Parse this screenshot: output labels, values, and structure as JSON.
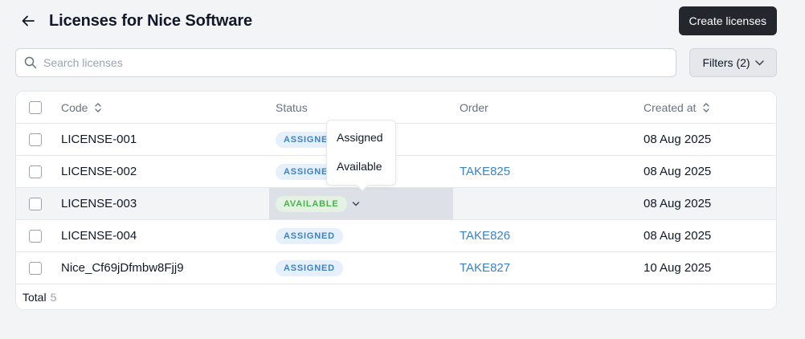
{
  "header": {
    "title": "Licenses for Nice Software",
    "create_label": "Create licenses"
  },
  "search": {
    "placeholder": "Search licenses",
    "value": ""
  },
  "filters": {
    "label": "Filters (2)"
  },
  "table": {
    "columns": [
      "Code",
      "Status",
      "Order",
      "Created at"
    ],
    "rows": [
      {
        "code": "LICENSE-001",
        "status": "ASSIGNED",
        "order": "",
        "created": "08 Aug 2025"
      },
      {
        "code": "LICENSE-002",
        "status": "ASSIGNED",
        "order": "TAKE825",
        "created": "08 Aug 2025"
      },
      {
        "code": "LICENSE-003",
        "status": "AVAILABLE",
        "order": "",
        "created": "08 Aug 2025"
      },
      {
        "code": "LICENSE-004",
        "status": "ASSIGNED",
        "order": "TAKE826",
        "created": "08 Aug 2025"
      },
      {
        "code": "Nice_Cf69jDfmbw8Fjj9",
        "status": "ASSIGNED",
        "order": "TAKE827",
        "created": "10 Aug 2025"
      }
    ],
    "total_label": "Total",
    "total_count": "5"
  },
  "status_dropdown": {
    "options": [
      "Assigned",
      "Available"
    ]
  },
  "colors": {
    "primary_button": "#23262c",
    "assigned_badge_bg": "#e6f0fb",
    "assigned_badge_text": "#3b82c4",
    "available_badge_bg": "#e3f2e3",
    "available_badge_text": "#4caf50",
    "link": "#3b82c4"
  },
  "icons": {
    "back": "arrow-left-icon",
    "search": "search-icon",
    "filters": "chevron-down-icon",
    "sort": "sort-icon"
  }
}
